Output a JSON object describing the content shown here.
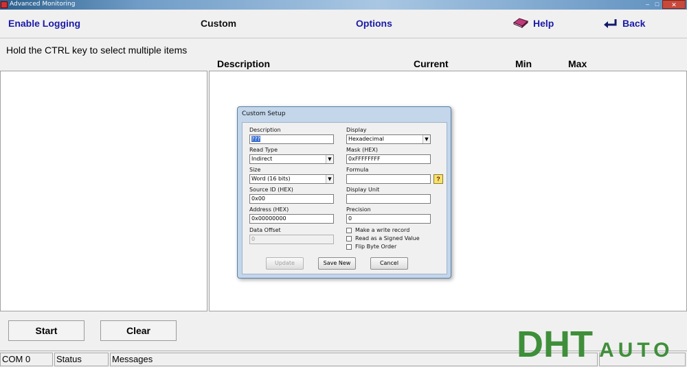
{
  "window": {
    "title": "Advanced Monitoring"
  },
  "menu": {
    "enable_logging": "Enable Logging",
    "custom": "Custom",
    "options": "Options",
    "help": "Help",
    "back": "Back"
  },
  "hint": "Hold the CTRL key to select multiple items",
  "columns": {
    "description": "Description",
    "current": "Current",
    "min": "Min",
    "max": "Max"
  },
  "dialog": {
    "title": "Custom Setup",
    "description_label": "Description",
    "description_value": "???",
    "display_label": "Display",
    "display_value": "Hexadecimal",
    "read_type_label": "Read Type",
    "read_type_value": "Indirect",
    "mask_label": "Mask (HEX)",
    "mask_value": "0xFFFFFFFF",
    "size_label": "Size",
    "size_value": "Word (16 bits)",
    "formula_label": "Formula",
    "formula_value": "",
    "source_id_label": "Source ID (HEX)",
    "source_id_value": "0x00",
    "display_unit_label": "Display Unit",
    "display_unit_value": "",
    "address_label": "Address (HEX)",
    "address_value": "0x00000000",
    "precision_label": "Precision",
    "precision_value": "0",
    "data_offset_label": "Data Offset",
    "data_offset_value": "0",
    "chk_write_record": "Make a write record",
    "chk_signed": "Read as a Signed Value",
    "chk_flip": "Flip Byte Order",
    "btn_update": "Update",
    "btn_save_new": "Save New",
    "btn_cancel": "Cancel"
  },
  "buttons": {
    "start": "Start",
    "clear": "Clear"
  },
  "status": {
    "com": "COM 0",
    "status": "Status",
    "messages": "Messages"
  },
  "logo": {
    "text_main": "DHT",
    "text_auto": "AUTO",
    "color": "#3f8f3a"
  },
  "icons": {
    "help": "help-book-icon",
    "back": "back-arrow-icon"
  }
}
